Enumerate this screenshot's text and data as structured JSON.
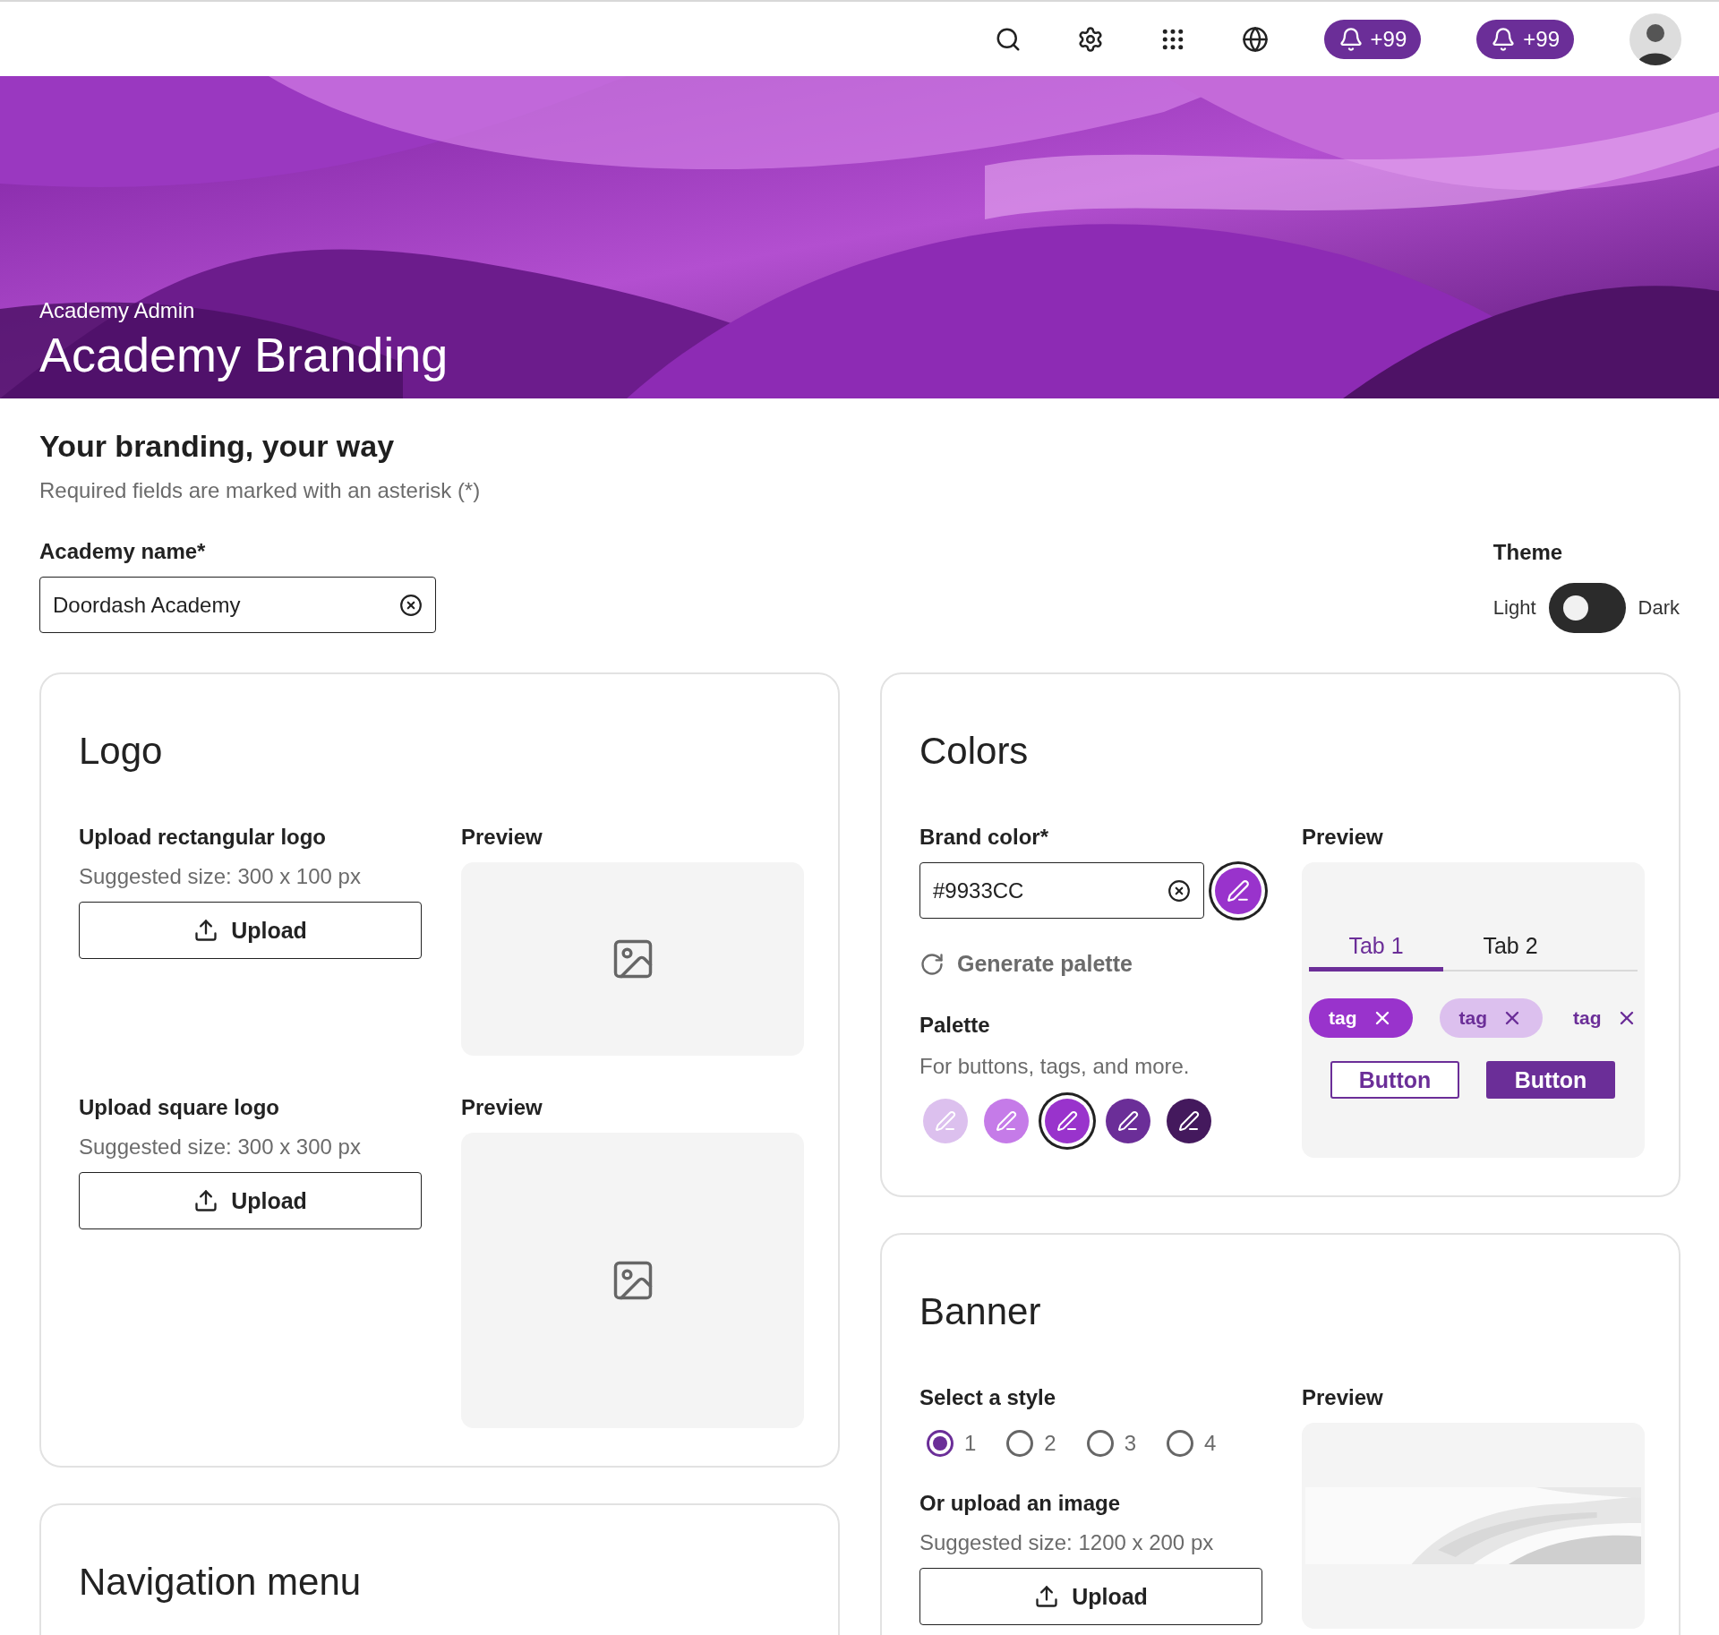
{
  "topbar": {
    "badges": [
      {
        "count": "+99"
      },
      {
        "count": "+99"
      }
    ]
  },
  "hero": {
    "breadcrumb": "Academy Admin",
    "title": "Academy Branding"
  },
  "heading": "Your branding, your way",
  "subheading": "Required fields are marked with an asterisk (*)",
  "academy_name": {
    "label": "Academy name*",
    "value": "Doordash Academy"
  },
  "theme": {
    "label": "Theme",
    "light": "Light",
    "dark": "Dark",
    "on": false
  },
  "logo": {
    "title": "Logo",
    "sections": [
      {
        "label": "Upload rectangular logo",
        "hint": "Suggested size: 300 x 100 px",
        "button": "Upload",
        "preview_label": "Preview"
      },
      {
        "label": "Upload square logo",
        "hint": "Suggested size: 300 x 300 px",
        "button": "Upload",
        "preview_label": "Preview"
      }
    ]
  },
  "colors": {
    "title": "Colors",
    "brand_label": "Brand color*",
    "value": "#9933CC",
    "generate": "Generate palette",
    "palette_label": "Palette",
    "palette_hint": "For buttons, tags, and more.",
    "swatches": [
      {
        "color": "#dcc0ee",
        "selected": false
      },
      {
        "color": "#c57be8",
        "selected": false
      },
      {
        "color": "#9933cc",
        "selected": true
      },
      {
        "color": "#6b2e98",
        "selected": false
      },
      {
        "color": "#44195d",
        "selected": false
      }
    ],
    "preview_label": "Preview",
    "tabs": [
      {
        "label": "Tab 1",
        "selected": true
      },
      {
        "label": "Tab 2",
        "selected": false
      }
    ],
    "tags": [
      {
        "label": "tag",
        "kind": "filled"
      },
      {
        "label": "tag",
        "kind": "soft"
      },
      {
        "label": "tag",
        "kind": "plain"
      }
    ],
    "buttons": [
      {
        "label": "Button",
        "kind": "outline"
      },
      {
        "label": "Button",
        "kind": "solid"
      }
    ]
  },
  "banner": {
    "title": "Banner",
    "style_label": "Select a style",
    "styles": [
      {
        "label": "1",
        "selected": true
      },
      {
        "label": "2",
        "selected": false
      },
      {
        "label": "3",
        "selected": false
      },
      {
        "label": "4",
        "selected": false
      }
    ],
    "upload_label": "Or upload an image",
    "hint": "Suggested size: 1200 x 200 px",
    "button": "Upload",
    "preview_label": "Preview"
  },
  "navigation": {
    "title": "Navigation menu"
  }
}
